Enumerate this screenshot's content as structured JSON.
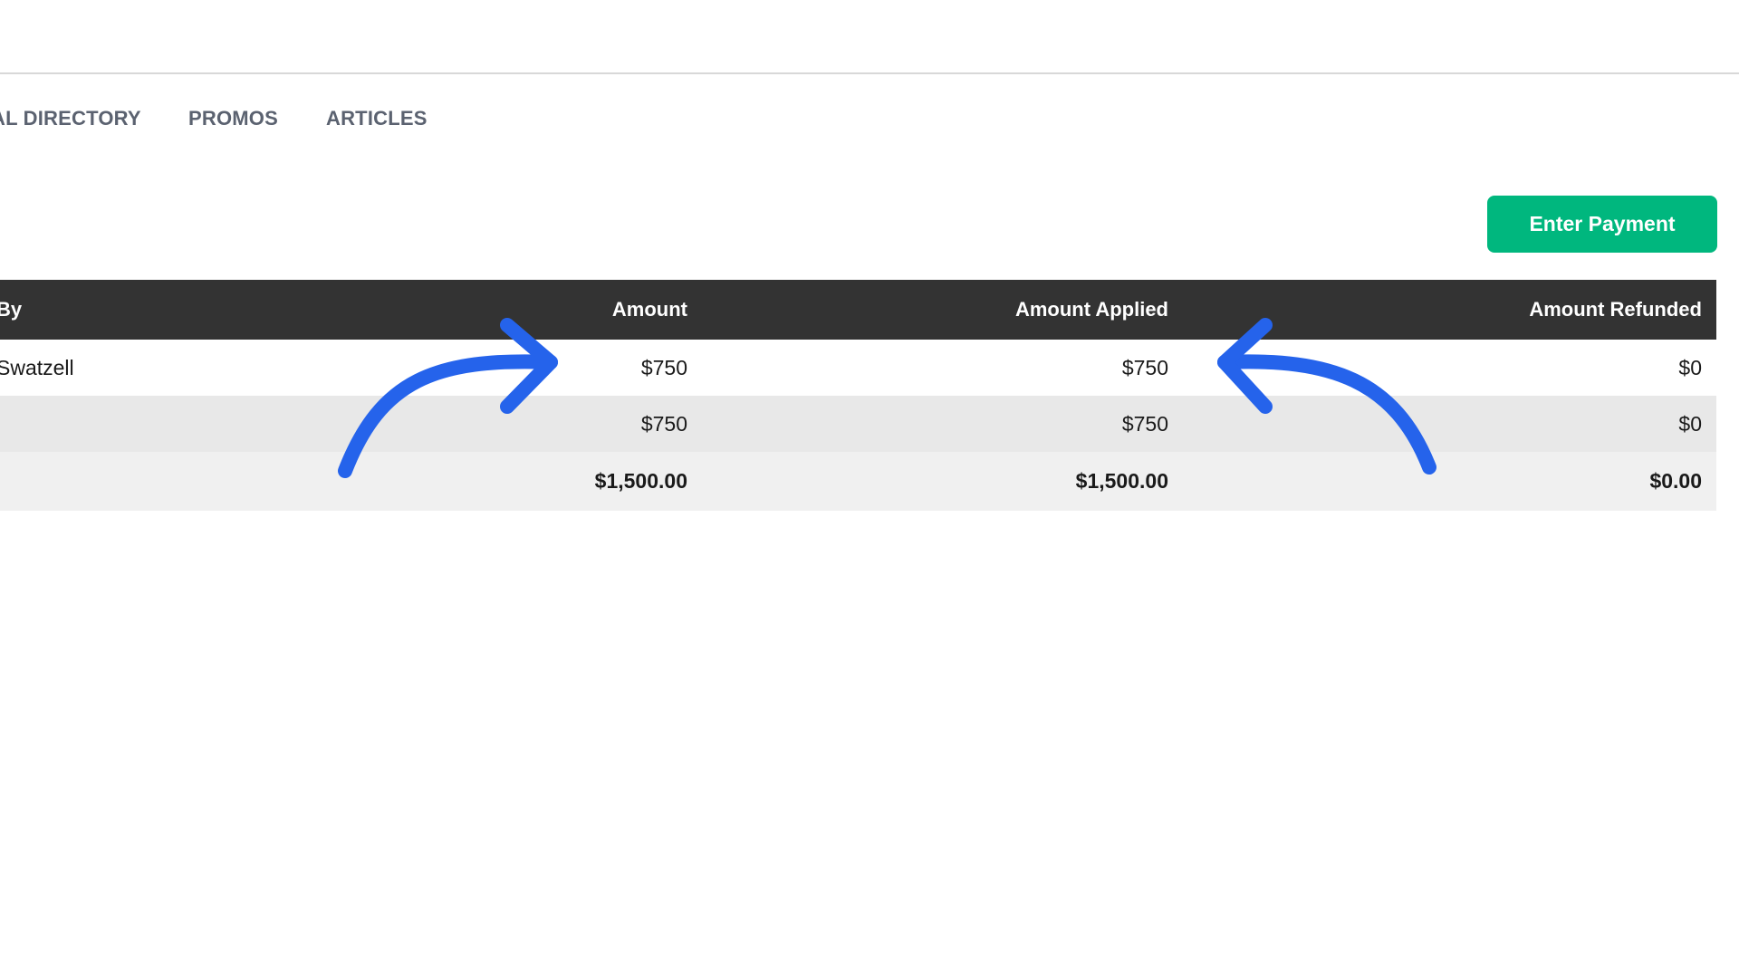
{
  "nav": {
    "tabs": [
      {
        "label": "AL DIRECTORY"
      },
      {
        "label": "PROMOS"
      },
      {
        "label": "ARTICLES"
      }
    ]
  },
  "actions": {
    "enter_payment_label": "Enter Payment"
  },
  "table": {
    "headers": {
      "by": "By",
      "amount": "Amount",
      "amount_applied": "Amount Applied",
      "amount_refunded": "Amount Refunded"
    },
    "rows": [
      {
        "by": "Swatzell",
        "amount": "$750",
        "amount_applied": "$750",
        "amount_refunded": "$0"
      },
      {
        "by": "",
        "amount": "$750",
        "amount_applied": "$750",
        "amount_refunded": "$0"
      }
    ],
    "totals": {
      "amount": "$1,500.00",
      "amount_applied": "$1,500.00",
      "amount_refunded": "$0.00"
    }
  },
  "colors": {
    "header_bg": "#333333",
    "button_bg": "#00b77e",
    "annotation_arrow": "#2563eb"
  },
  "annotations": {
    "arrow_icons": [
      "curved-arrow-right-icon",
      "curved-arrow-left-icon"
    ]
  }
}
